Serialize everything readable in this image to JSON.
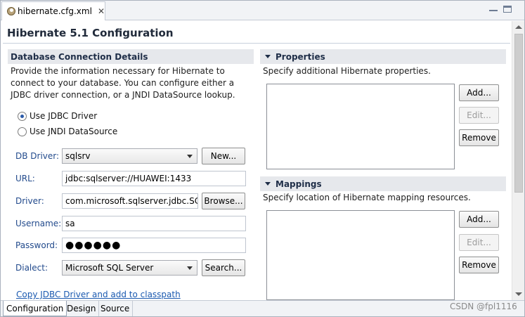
{
  "tab": {
    "file_name": "hibernate.cfg.xml",
    "close_glyph": "✕"
  },
  "header": {
    "title": "Hibernate 5.1 Configuration"
  },
  "db_section": {
    "title": "Database Connection Details",
    "description": "Provide the information necessary for Hibernate to connect to your database.  You can configure either a JDBC driver connection, or a JNDI DataSource lookup.",
    "radio_jdbc": "Use JDBC Driver",
    "radio_jndi": "Use JNDI DataSource",
    "selected_mode": "jdbc",
    "fields": {
      "db_driver_label": "DB Driver:",
      "db_driver_value": "sqlsrv",
      "new_button": "New...",
      "url_label": "URL:",
      "url_value": "jdbc:sqlserver://HUAWEI:1433",
      "driver_label": "Driver:",
      "driver_value": "com.microsoft.sqlserver.jdbc.SC",
      "browse_button": "Browse...",
      "username_label": "Username:",
      "username_value": "sa",
      "password_label": "Password:",
      "password_value": "●●●●●●",
      "dialect_label": "Dialect:",
      "dialect_value": "Microsoft SQL Server",
      "search_button": "Search..."
    },
    "copy_link": "Copy JDBC Driver and add to classpath"
  },
  "properties_section": {
    "title": "Properties",
    "description": "Specify additional Hibernate properties.",
    "add_button": "Add...",
    "edit_button": "Edit...",
    "remove_button": "Remove"
  },
  "mappings_section": {
    "title": "Mappings",
    "description": "Specify location of Hibernate mapping resources.",
    "add_button": "Add...",
    "edit_button": "Edit...",
    "remove_button": "Remove"
  },
  "bottom_tabs": [
    {
      "label": "Configuration",
      "active": true
    },
    {
      "label": "Design",
      "active": false
    },
    {
      "label": "Source",
      "active": false
    }
  ],
  "watermark": "CSDN @fpl1116",
  "colors": {
    "accent": "#224a8c",
    "link": "#1b5ab0",
    "header_bg": "#e6e8ec"
  }
}
